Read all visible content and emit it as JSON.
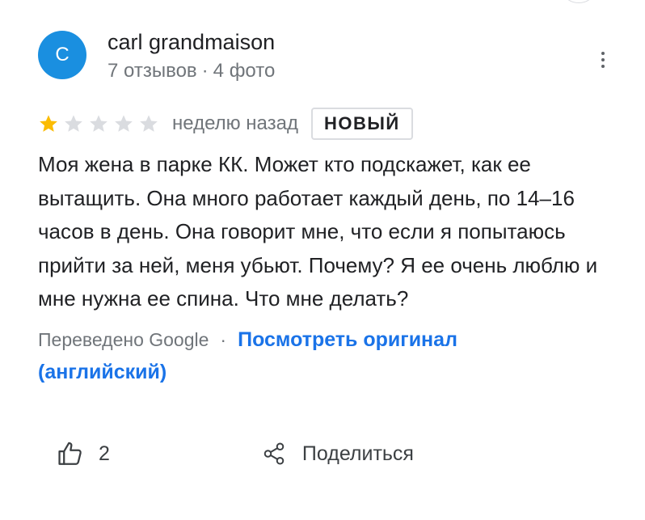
{
  "review": {
    "author": {
      "avatar_letter": "C",
      "avatar_color": "#1a8fe0",
      "name": "carl grandmaison",
      "reviews_count": "7 отзывов",
      "photos_count": "4 фото"
    },
    "menu_icon": "more-vert-icon",
    "rating": {
      "value": 1,
      "max": 5,
      "filled_color": "#fbbc04",
      "empty_color": "#dadce0"
    },
    "date": "неделю назад",
    "badge": "НОВЫЙ",
    "text": "Моя жена в парке КК. Может кто подскажет, как ее вытащить. Она много работает каждый день, по 14–16 часов в день. Она говорит мне, что если я попытаюсь прийти за ней, меня убьют. Почему? Я ее очень люблю и мне нужна ее спина. Что мне делать?",
    "translation": {
      "note": "Переведено Google",
      "separator": "·",
      "link_label": "Посмотреть оригинал (английский)",
      "link_color": "#1a73e8"
    }
  },
  "actions": {
    "like": {
      "icon": "thumb-up-icon",
      "count": "2"
    },
    "share": {
      "icon": "share-icon",
      "label": "Поделиться"
    }
  }
}
